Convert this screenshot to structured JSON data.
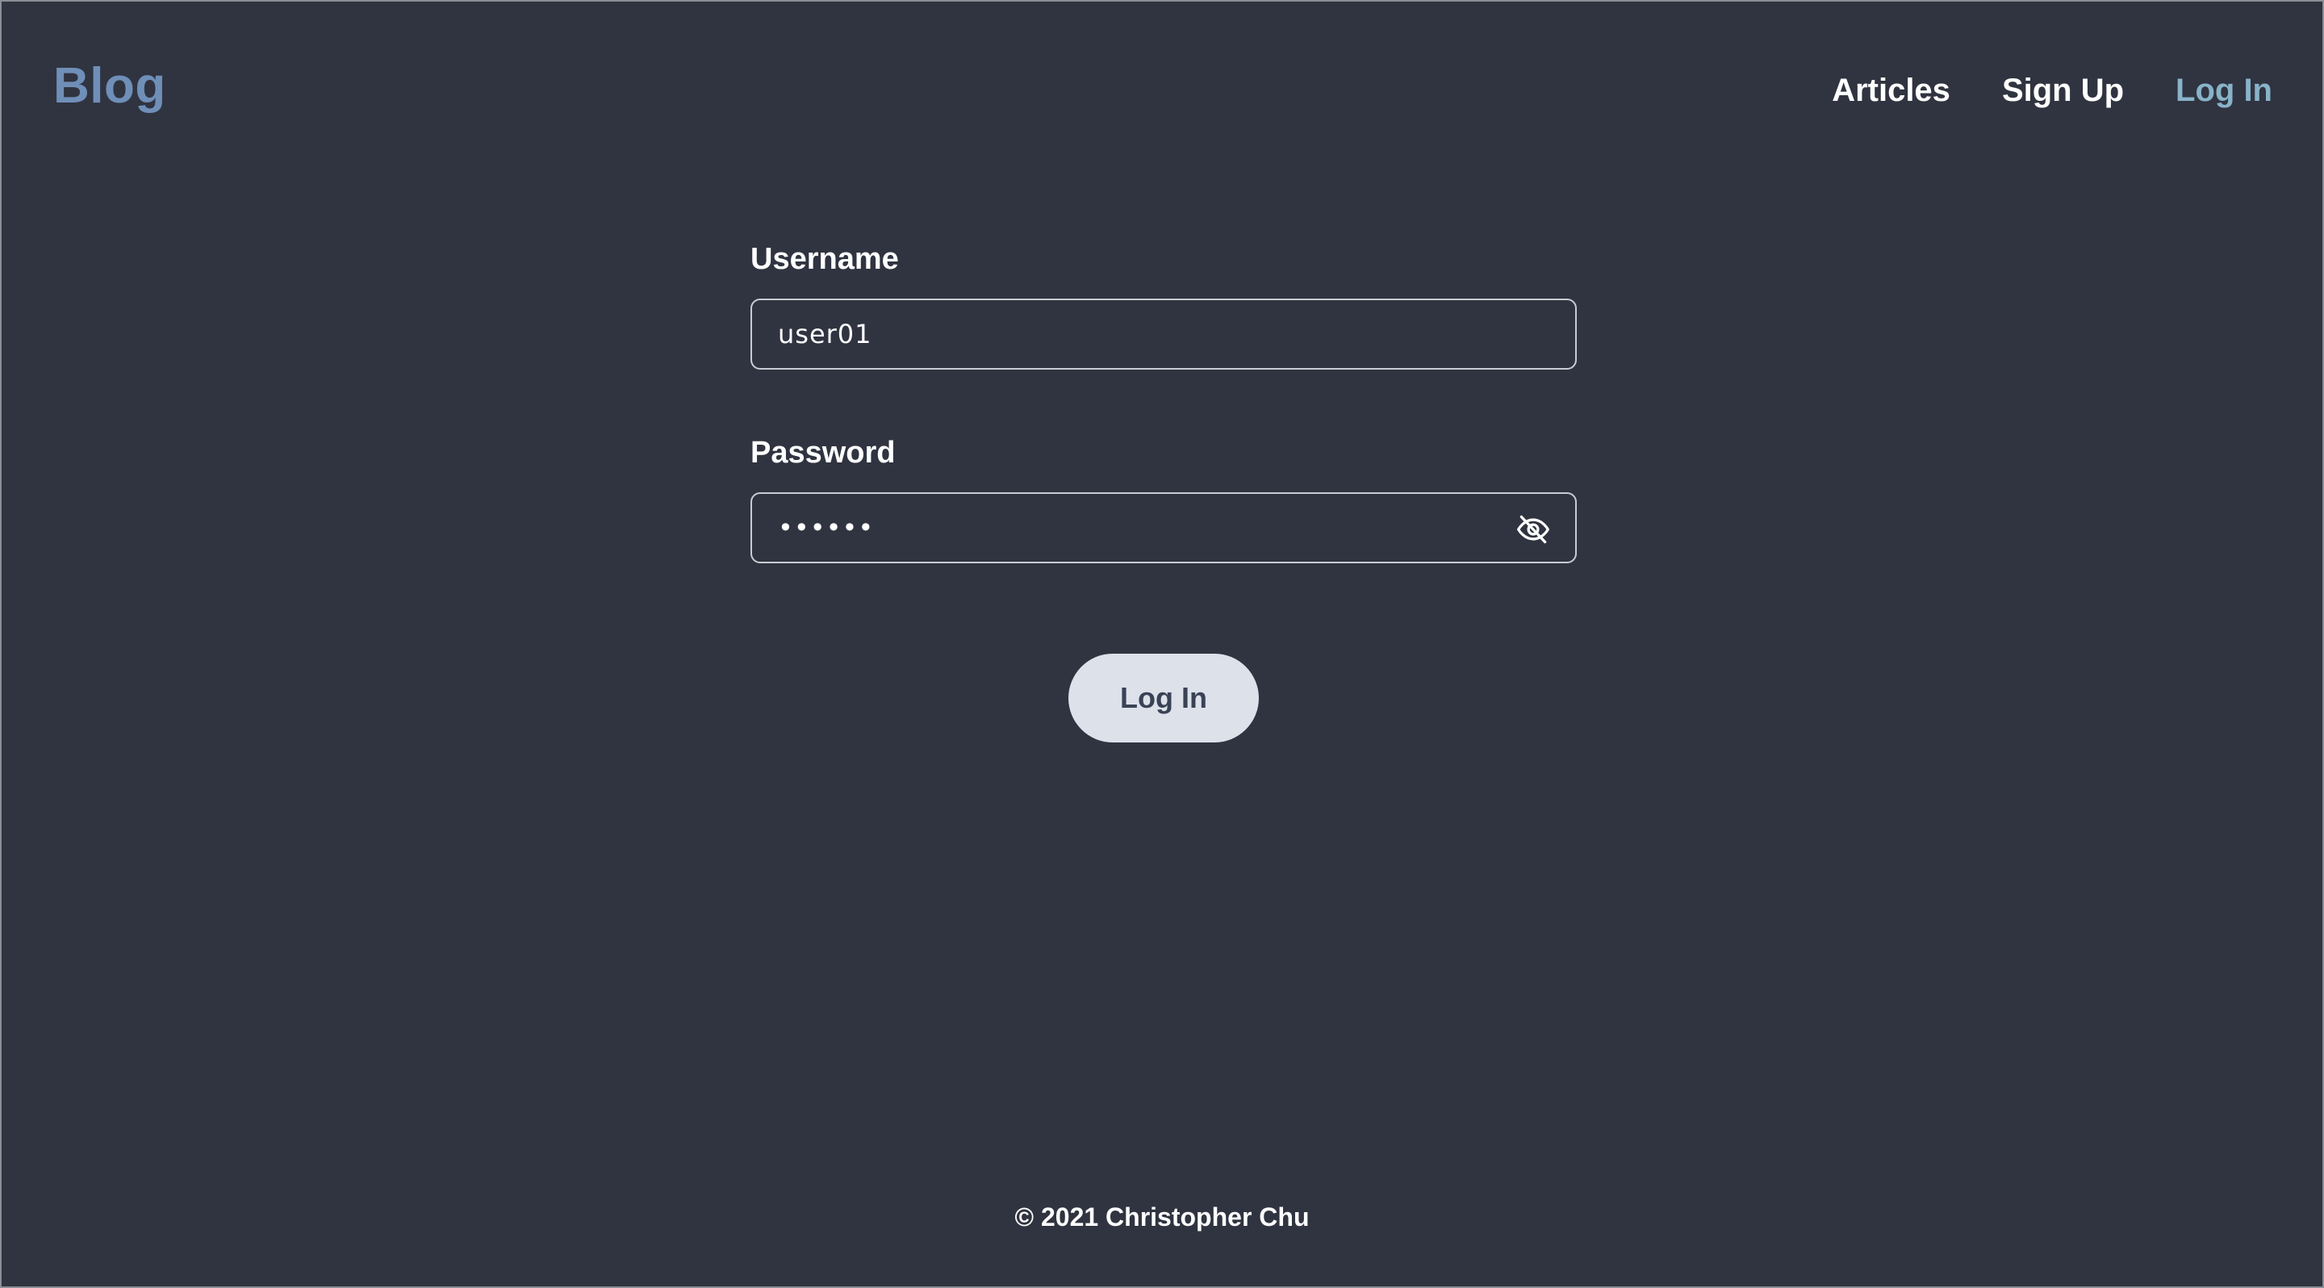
{
  "header": {
    "brand": "Blog",
    "nav": [
      {
        "label": "Articles",
        "active": false
      },
      {
        "label": "Sign Up",
        "active": false
      },
      {
        "label": "Log In",
        "active": true
      }
    ]
  },
  "form": {
    "username": {
      "label": "Username",
      "value": "user01"
    },
    "password": {
      "label": "Password",
      "value": "••••••",
      "toggle_icon": "eye-off-icon"
    },
    "submit_label": "Log In"
  },
  "footer": {
    "text": "© 2021 Christopher Chu"
  },
  "colors": {
    "background": "#303440",
    "brand": "#6f8fb8",
    "nav_active": "#88b3c9",
    "button_bg": "#dde1ea",
    "button_text": "#3a4356"
  }
}
